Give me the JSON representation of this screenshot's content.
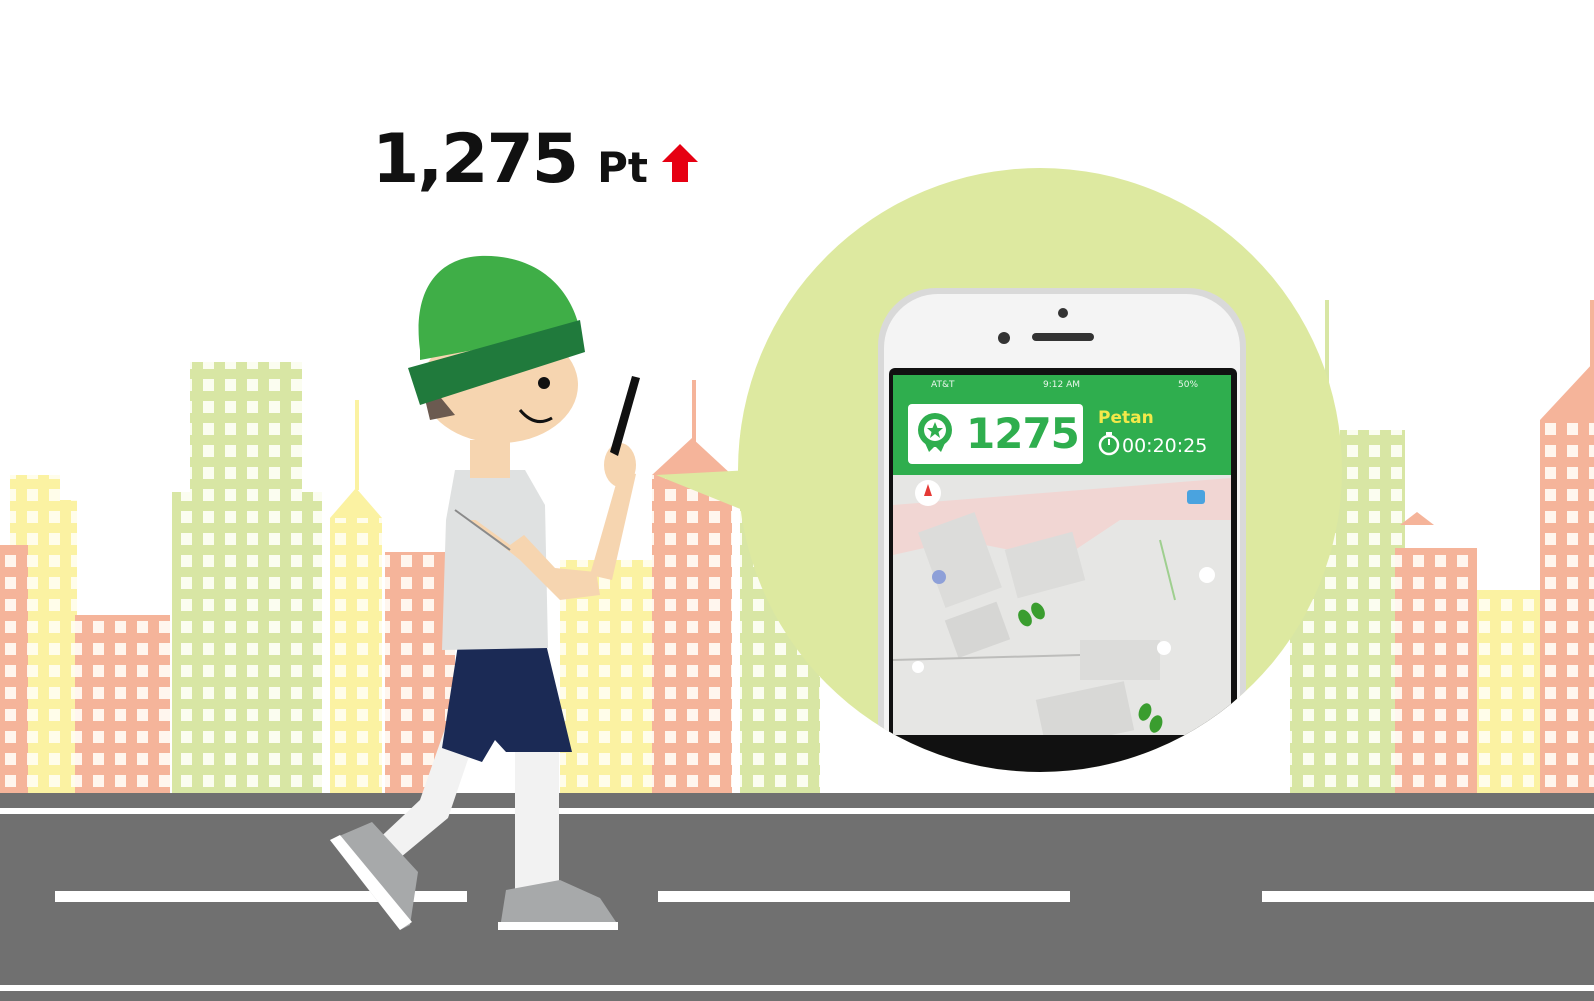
{
  "points": {
    "value": "1,275",
    "unit": "Pt",
    "trend": "up"
  },
  "phone": {
    "status_bar": {
      "carrier": "AT&T",
      "time": "9:12 AM",
      "battery": "50%"
    },
    "score": "1275",
    "app_name": "Petan",
    "timer": "00:20:25"
  },
  "colors": {
    "app_green": "#2fae4e",
    "bubble_green": "#dde9a0",
    "hat_green": "#3fae47",
    "road_gray": "#707070",
    "arrow_red": "#e60012"
  },
  "icons": [
    "award-icon",
    "stopwatch-icon",
    "compass-icon",
    "footprints-icon",
    "up-arrow-icon"
  ]
}
